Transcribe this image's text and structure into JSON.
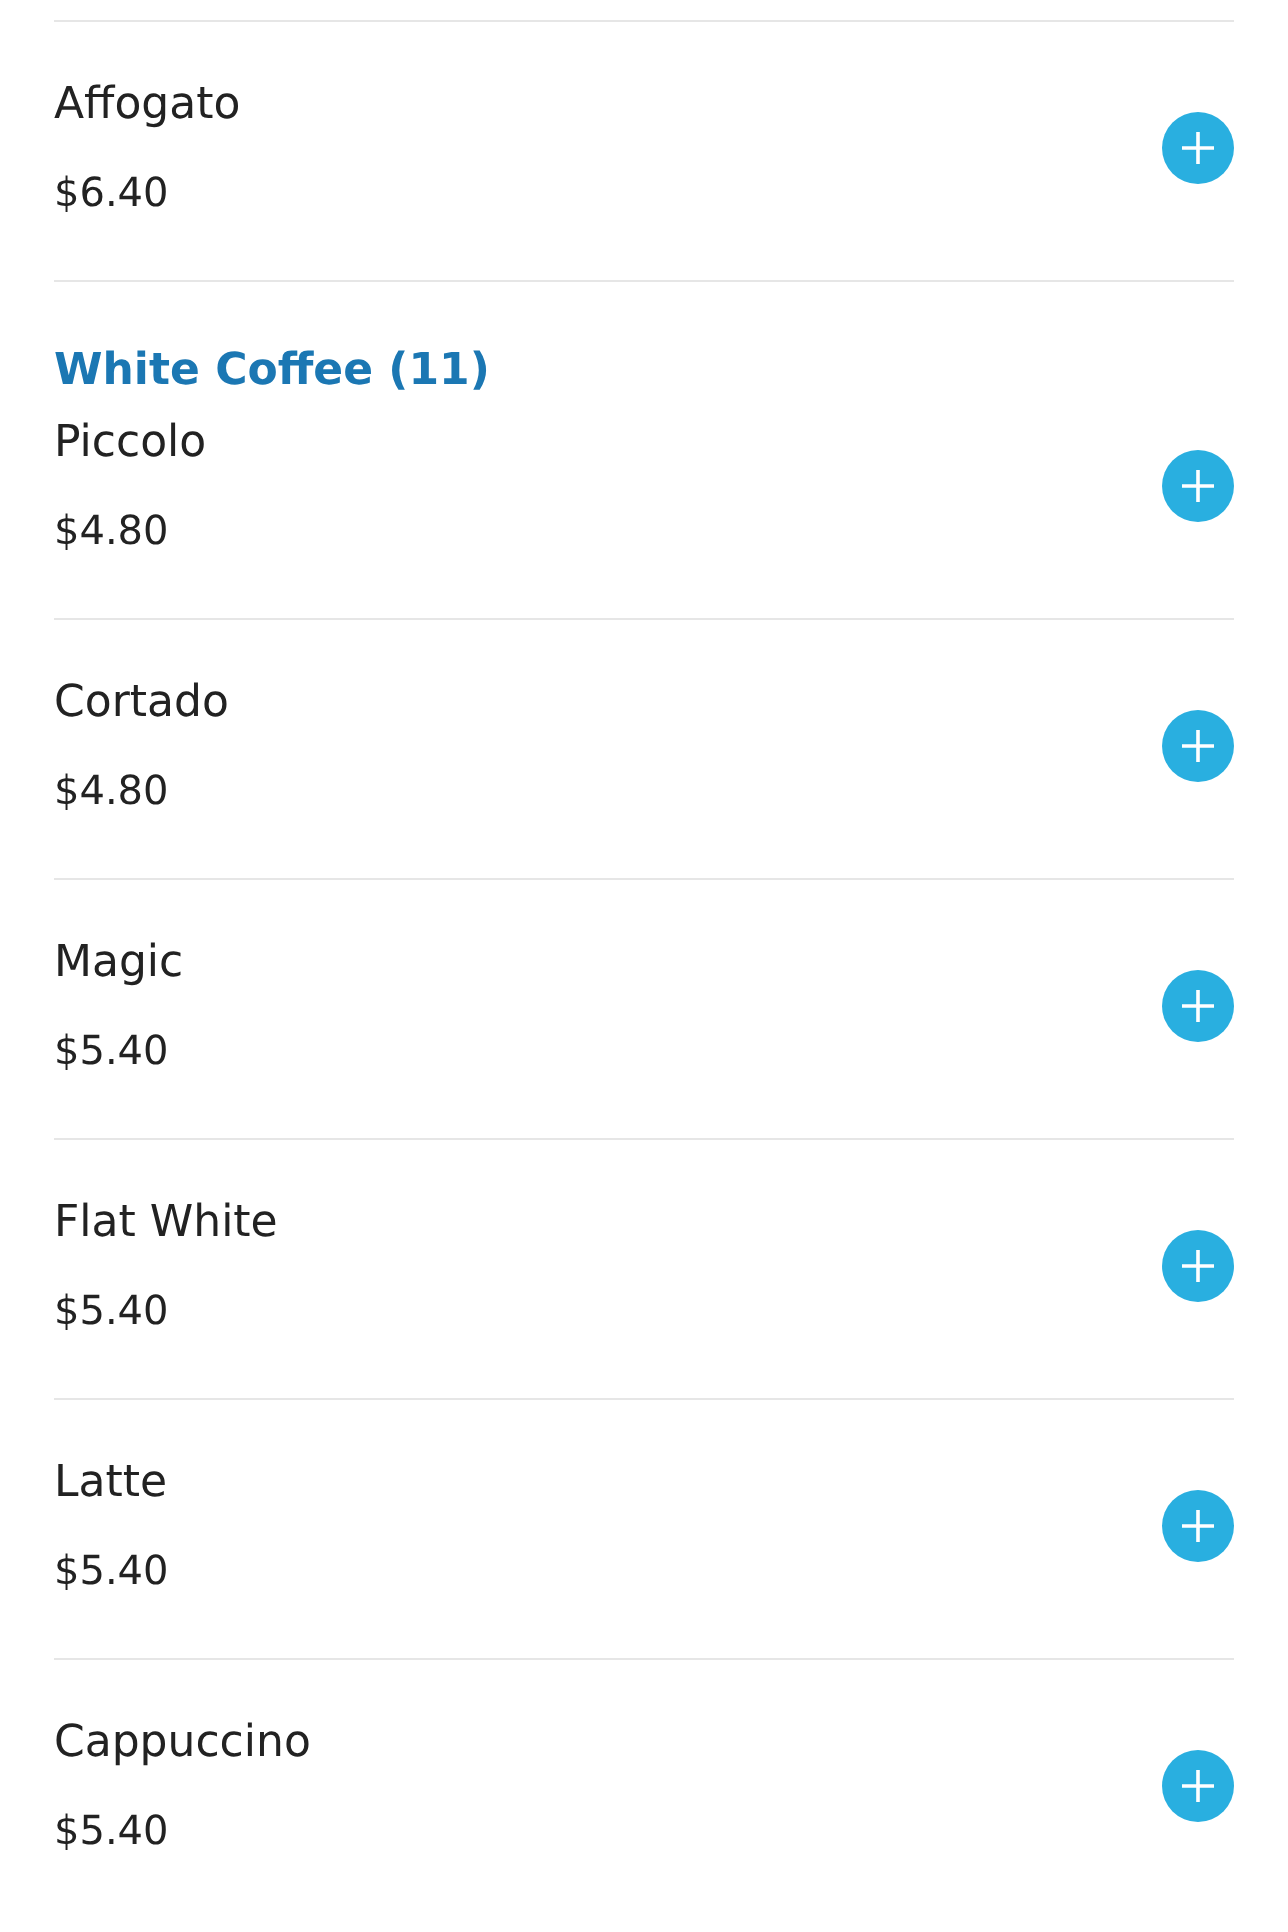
{
  "sections": [
    {
      "items": [
        {
          "name": "Affogato",
          "price": "$6.40"
        }
      ]
    },
    {
      "title": "White Coffee (11)",
      "items": [
        {
          "name": "Piccolo",
          "price": "$4.80"
        },
        {
          "name": "Cortado",
          "price": "$4.80"
        },
        {
          "name": "Magic",
          "price": "$5.40"
        },
        {
          "name": "Flat White",
          "price": "$5.40"
        },
        {
          "name": "Latte",
          "price": "$5.40"
        },
        {
          "name": "Cappuccino",
          "price": "$5.40"
        }
      ]
    }
  ]
}
